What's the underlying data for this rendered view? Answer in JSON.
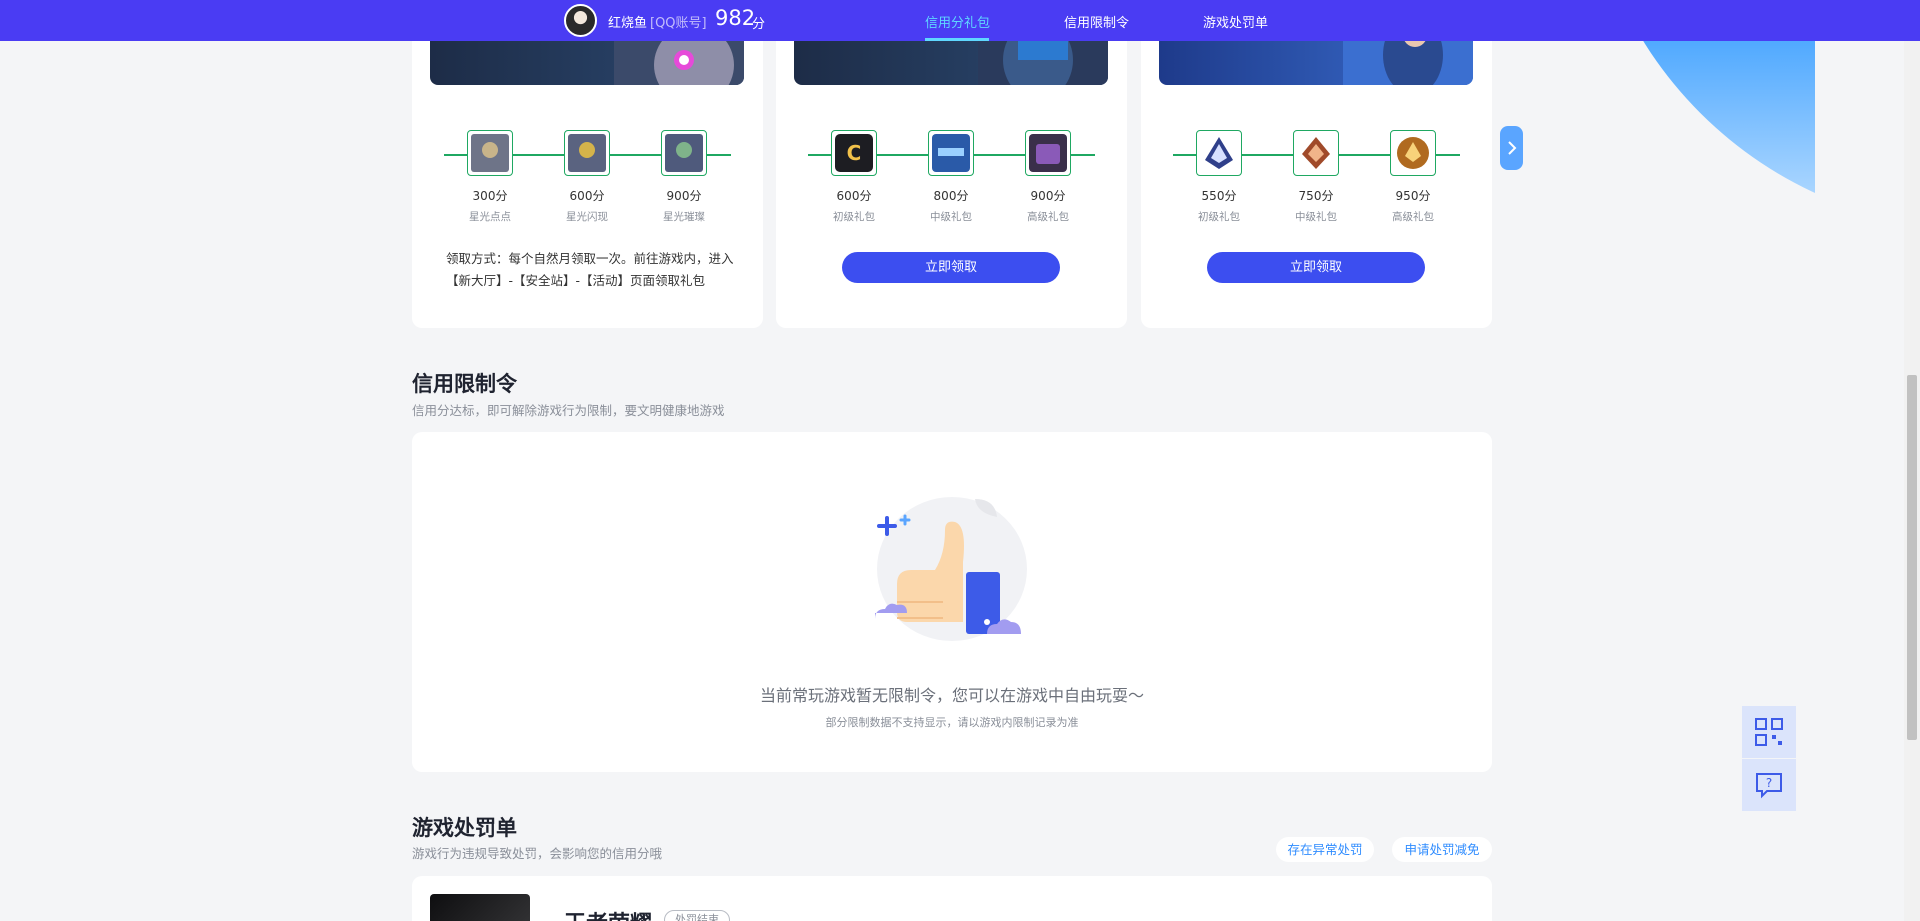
{
  "topbar": {
    "username": "红烧鱼",
    "account_type": "[QQ账号]",
    "score": "982",
    "score_unit": "分",
    "nav": [
      "信用分礼包",
      "信用限制令",
      "游戏处罚单"
    ],
    "active_nav": "信用分礼包"
  },
  "gift_cards": [
    {
      "tiers": [
        {
          "points": "300分",
          "label": "星光点点"
        },
        {
          "points": "600分",
          "label": "星光闪现"
        },
        {
          "points": "900分",
          "label": "星光璀璨"
        }
      ],
      "claim_info": "领取方式：每个自然月领取一次。前往游戏内，进入【新大厅】-【安全站】-【活动】页面领取礼包"
    },
    {
      "tiers": [
        {
          "points": "600分",
          "label": "初级礼包"
        },
        {
          "points": "800分",
          "label": "中级礼包"
        },
        {
          "points": "900分",
          "label": "高级礼包"
        }
      ],
      "button": "立即领取"
    },
    {
      "tiers": [
        {
          "points": "550分",
          "label": "初级礼包"
        },
        {
          "points": "750分",
          "label": "中级礼包"
        },
        {
          "points": "950分",
          "label": "高级礼包"
        }
      ],
      "button": "立即领取"
    }
  ],
  "restriction": {
    "title": "信用限制令",
    "subtitle": "信用分达标，即可解除游戏行为限制，要文明健康地游戏",
    "empty_message": "当前常玩游戏暂无限制令，您可以在游戏中自由玩耍～",
    "empty_note": "部分限制数据不支持显示，请以游戏内限制记录为准"
  },
  "penalty": {
    "title": "游戏处罚单",
    "subtitle": "游戏行为违规导致处罚，会影响您的信用分哦",
    "actions": [
      "存在异常处罚",
      "申请处罚减免"
    ],
    "game_name": "王者荣耀",
    "status_badge": "处罚结束"
  },
  "colors": {
    "topbar": "#4a3cf3",
    "accent": "#3c4ef0",
    "track": "#1fa862",
    "active_nav": "#5fd7ff"
  },
  "icons": [
    "next-arrow-icon",
    "qr-code-icon",
    "help-chat-icon",
    "thumbs-up-illustration"
  ]
}
